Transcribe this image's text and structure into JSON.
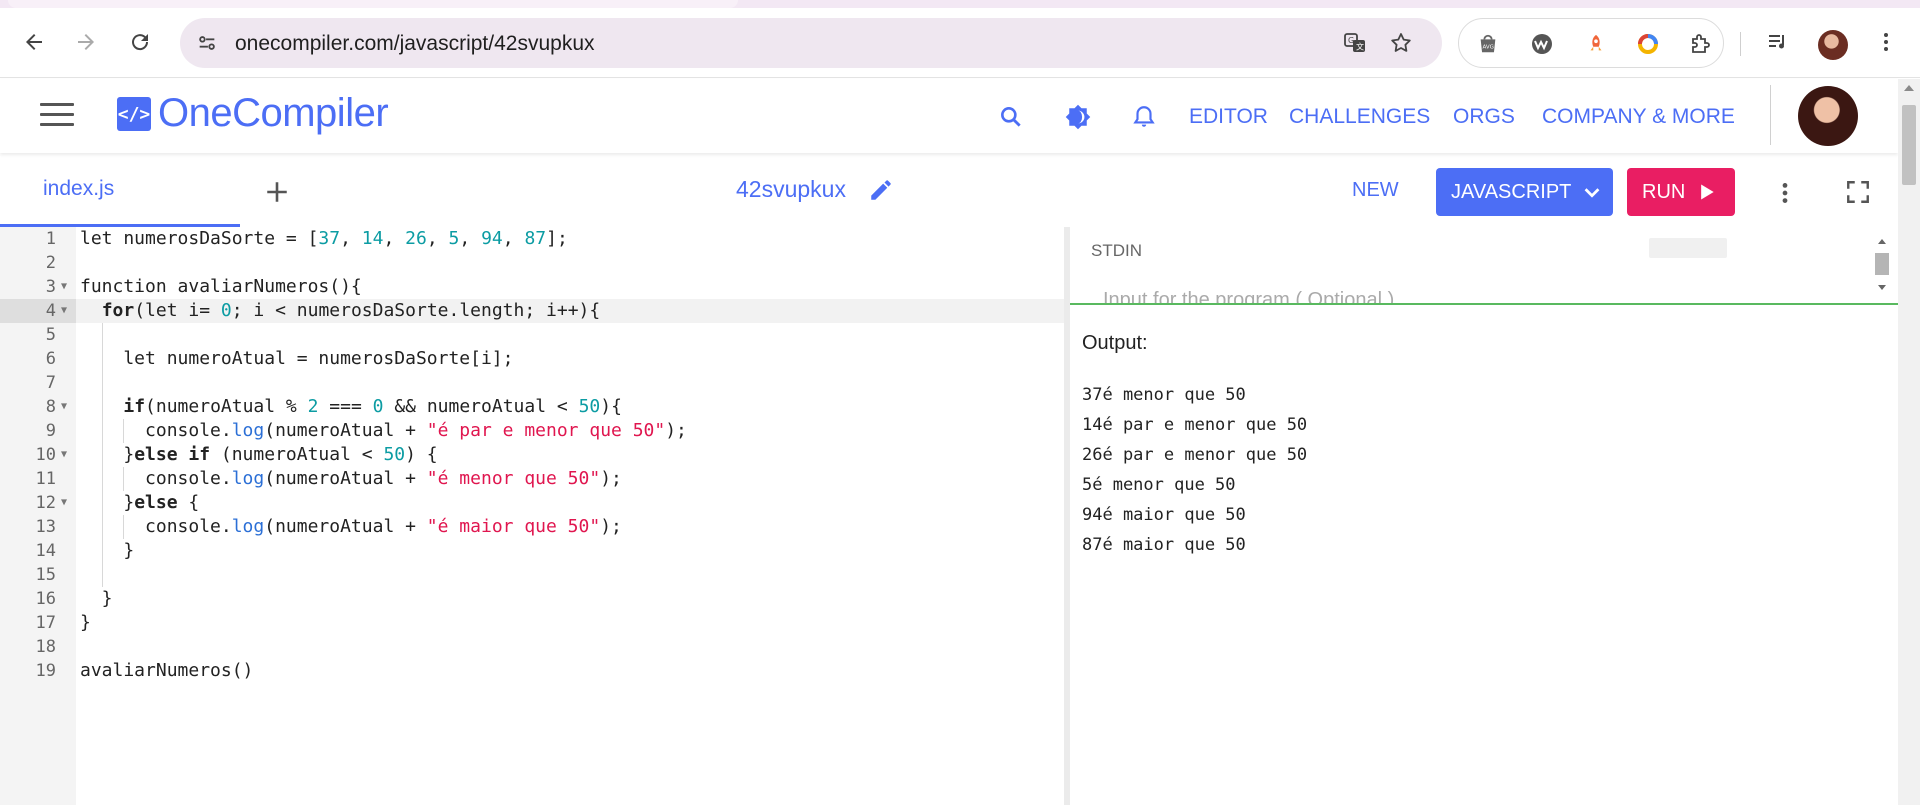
{
  "browser": {
    "url": "onecompiler.com/javascript/42svupkux"
  },
  "header": {
    "logo": "OneCompiler",
    "logo_mark": "</>",
    "nav": [
      "EDITOR",
      "CHALLENGES",
      "ORGS",
      "COMPANY & MORE"
    ]
  },
  "toolbar": {
    "file_tab": "index.js",
    "project_name": "42svupkux",
    "new_label": "NEW",
    "language_label": "JAVASCRIPT",
    "run_label": "RUN"
  },
  "editor": {
    "active_line": 4,
    "fold_lines": [
      3,
      4,
      8,
      10,
      12
    ],
    "lines": [
      [
        [
          "t",
          "let numerosDaSorte = ["
        ],
        [
          "n",
          "37"
        ],
        [
          "t",
          ", "
        ],
        [
          "n",
          "14"
        ],
        [
          "t",
          ", "
        ],
        [
          "n",
          "26"
        ],
        [
          "t",
          ", "
        ],
        [
          "n",
          "5"
        ],
        [
          "t",
          ", "
        ],
        [
          "n",
          "94"
        ],
        [
          "t",
          ", "
        ],
        [
          "n",
          "87"
        ],
        [
          "t",
          "];"
        ]
      ],
      [],
      [
        [
          "t",
          "function avaliarNumeros(){"
        ]
      ],
      [
        [
          "t",
          "  "
        ],
        [
          "k",
          "for"
        ],
        [
          "t",
          "(let i= "
        ],
        [
          "n",
          "0"
        ],
        [
          "t",
          "; i < numerosDaSorte.length; i++){"
        ]
      ],
      [],
      [
        [
          "t",
          "    let numeroAtual = numerosDaSorte[i];"
        ]
      ],
      [],
      [
        [
          "t",
          "    "
        ],
        [
          "k",
          "if"
        ],
        [
          "t",
          "(numeroAtual % "
        ],
        [
          "n",
          "2"
        ],
        [
          "t",
          " === "
        ],
        [
          "n",
          "0"
        ],
        [
          "t",
          " && numeroAtual < "
        ],
        [
          "n",
          "50"
        ],
        [
          "t",
          "){"
        ]
      ],
      [
        [
          "t",
          "      console."
        ],
        [
          "f",
          "log"
        ],
        [
          "t",
          "(numeroAtual + "
        ],
        [
          "s",
          "\"é par e menor que 50\""
        ],
        [
          "t",
          ");"
        ]
      ],
      [
        [
          "t",
          "    }"
        ],
        [
          "k",
          "else if"
        ],
        [
          "t",
          " (numeroAtual < "
        ],
        [
          "n",
          "50"
        ],
        [
          "t",
          ") {"
        ]
      ],
      [
        [
          "t",
          "      console."
        ],
        [
          "f",
          "log"
        ],
        [
          "t",
          "(numeroAtual + "
        ],
        [
          "s",
          "\"é menor que 50\""
        ],
        [
          "t",
          ");"
        ]
      ],
      [
        [
          "t",
          "    }"
        ],
        [
          "k",
          "else"
        ],
        [
          "t",
          " {"
        ]
      ],
      [
        [
          "t",
          "      console."
        ],
        [
          "f",
          "log"
        ],
        [
          "t",
          "(numeroAtual + "
        ],
        [
          "s",
          "\"é maior que 50\""
        ],
        [
          "t",
          ");"
        ]
      ],
      [
        [
          "t",
          "    }"
        ]
      ],
      [],
      [
        [
          "t",
          "  }"
        ]
      ],
      [
        [
          "t",
          "}"
        ]
      ],
      [],
      [
        [
          "t",
          "avaliarNumeros()"
        ]
      ]
    ]
  },
  "stdin": {
    "label": "STDIN",
    "placeholder": "Input for the program ( Optional )"
  },
  "output": {
    "label": "Output:",
    "lines": [
      "37é menor que 50",
      "14é par e menor que 50",
      "26é par e menor que 50",
      "5é menor que 50",
      "94é maior que 50",
      "87é maior que 50"
    ]
  },
  "colors": {
    "brand": "#4c6ef5",
    "run": "#e91e63",
    "number": "#0c9ca3",
    "string": "#e0164f",
    "divider_green": "#59b95f"
  }
}
